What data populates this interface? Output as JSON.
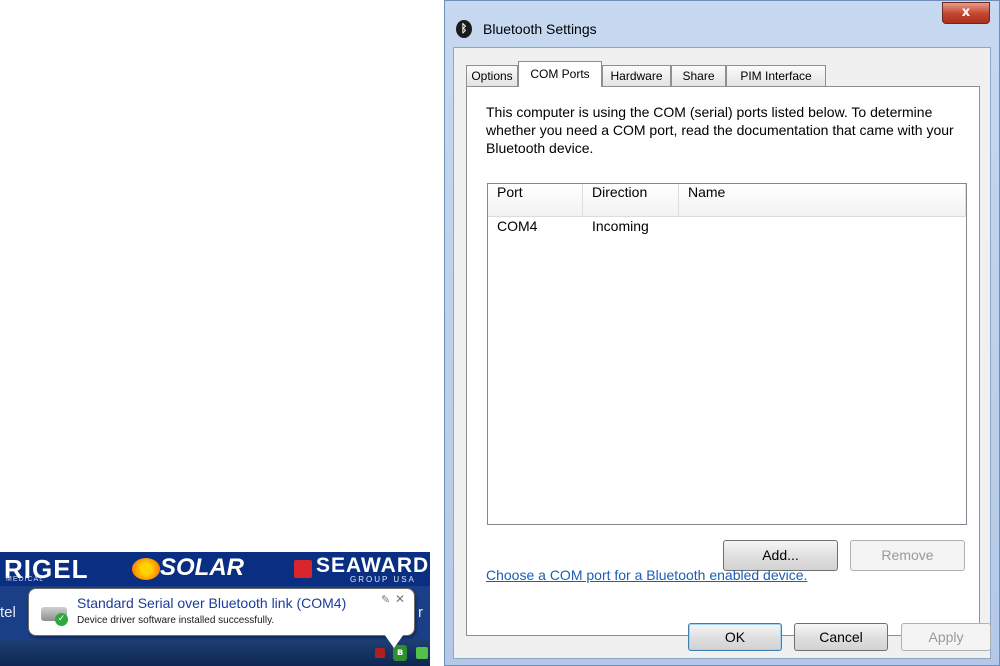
{
  "desktop": {
    "banner": {
      "rigel": "RIGEL",
      "rigel_sub": "MEDICAL",
      "solar": "SOLAR",
      "seaward": "SEAWARD",
      "seaward_sub": "GROUP USA"
    },
    "text_left": "tel",
    "text_right": "r",
    "balloon": {
      "title": "Standard Serial over Bluetooth link (COM4)",
      "message": "Device driver software installed successfully.",
      "icon": "device-driver-check-icon"
    }
  },
  "window": {
    "title": "Bluetooth Settings",
    "title_icon": "bluetooth-icon",
    "close_label": "x",
    "tabs": [
      {
        "label": "Options",
        "active": false
      },
      {
        "label": "COM Ports",
        "active": true
      },
      {
        "label": "Hardware",
        "active": false
      },
      {
        "label": "Share",
        "active": false
      },
      {
        "label": "PIM Interface",
        "active": false
      }
    ],
    "description": "This computer is using the COM (serial) ports listed below. To determine whether you need a COM port, read the documentation that came with your Bluetooth device.",
    "table": {
      "columns": [
        "Port",
        "Direction",
        "Name"
      ],
      "rows": [
        {
          "port": "COM4",
          "direction": "Incoming",
          "name": ""
        }
      ]
    },
    "add_label": "Add...",
    "remove_label": "Remove",
    "link_text": "Choose a COM port for a Bluetooth enabled device.",
    "ok_label": "OK",
    "cancel_label": "Cancel",
    "apply_label": "Apply"
  }
}
